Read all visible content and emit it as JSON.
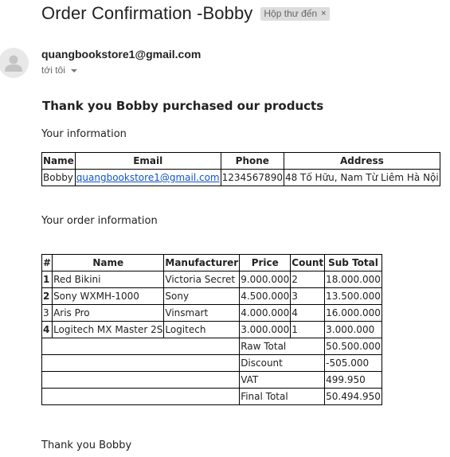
{
  "email": {
    "subject": "Order Confirmation -Bobby",
    "label": "Hộp thư đến",
    "label_remove": "×",
    "sender": "quangbookstore1@gmail.com",
    "recipient_line": "tới tôi"
  },
  "body": {
    "heading": "Thank you Bobby purchased our products",
    "info_label": "Your information",
    "order_label": "Your order information",
    "closing": "Thank you Bobby"
  },
  "info_table": {
    "headers": [
      "Name",
      "Email",
      "Phone",
      "Address"
    ],
    "row": {
      "name": "Bobby",
      "email": "quangbookstore1@gmail.com",
      "phone": "1234567890",
      "address": "48 Tố Hữu, Nam Từ Liêm Hà Nội"
    }
  },
  "order_table": {
    "headers": [
      "#",
      "Name",
      "Manufacturer",
      "Price",
      "Count",
      "Sub Total"
    ],
    "rows": [
      {
        "idx": "1",
        "name": "Red Bikini",
        "manufacturer": "Victoria Secret",
        "price": "9.000.000",
        "count": "2",
        "subtotal": "18.000.000"
      },
      {
        "idx": "2",
        "name": "Sony WXMH-1000",
        "manufacturer": "Sony",
        "price": "4.500.000",
        "count": "3",
        "subtotal": "13.500.000"
      },
      {
        "idx": "3",
        "name": "Aris Pro",
        "manufacturer": "Vinsmart",
        "price": "4.000.000",
        "count": "4",
        "subtotal": "16.000.000"
      },
      {
        "idx": "4",
        "name": "Logitech MX Master 2S",
        "manufacturer": "Logitech",
        "price": "3.000.000",
        "count": "1",
        "subtotal": "3.000.000"
      }
    ],
    "totals": [
      {
        "label": "Raw Total",
        "value": "50.500.000"
      },
      {
        "label": "Discount",
        "value": "-505.000"
      },
      {
        "label": "VAT",
        "value": "499.950"
      },
      {
        "label": "Final Total",
        "value": "50.494.950"
      }
    ]
  },
  "icons": {
    "avatar": "person-icon",
    "recipient_dropdown": "caret-down-icon"
  },
  "colors": {
    "link": "#1155cc",
    "label_chip_bg": "#dddddd"
  }
}
